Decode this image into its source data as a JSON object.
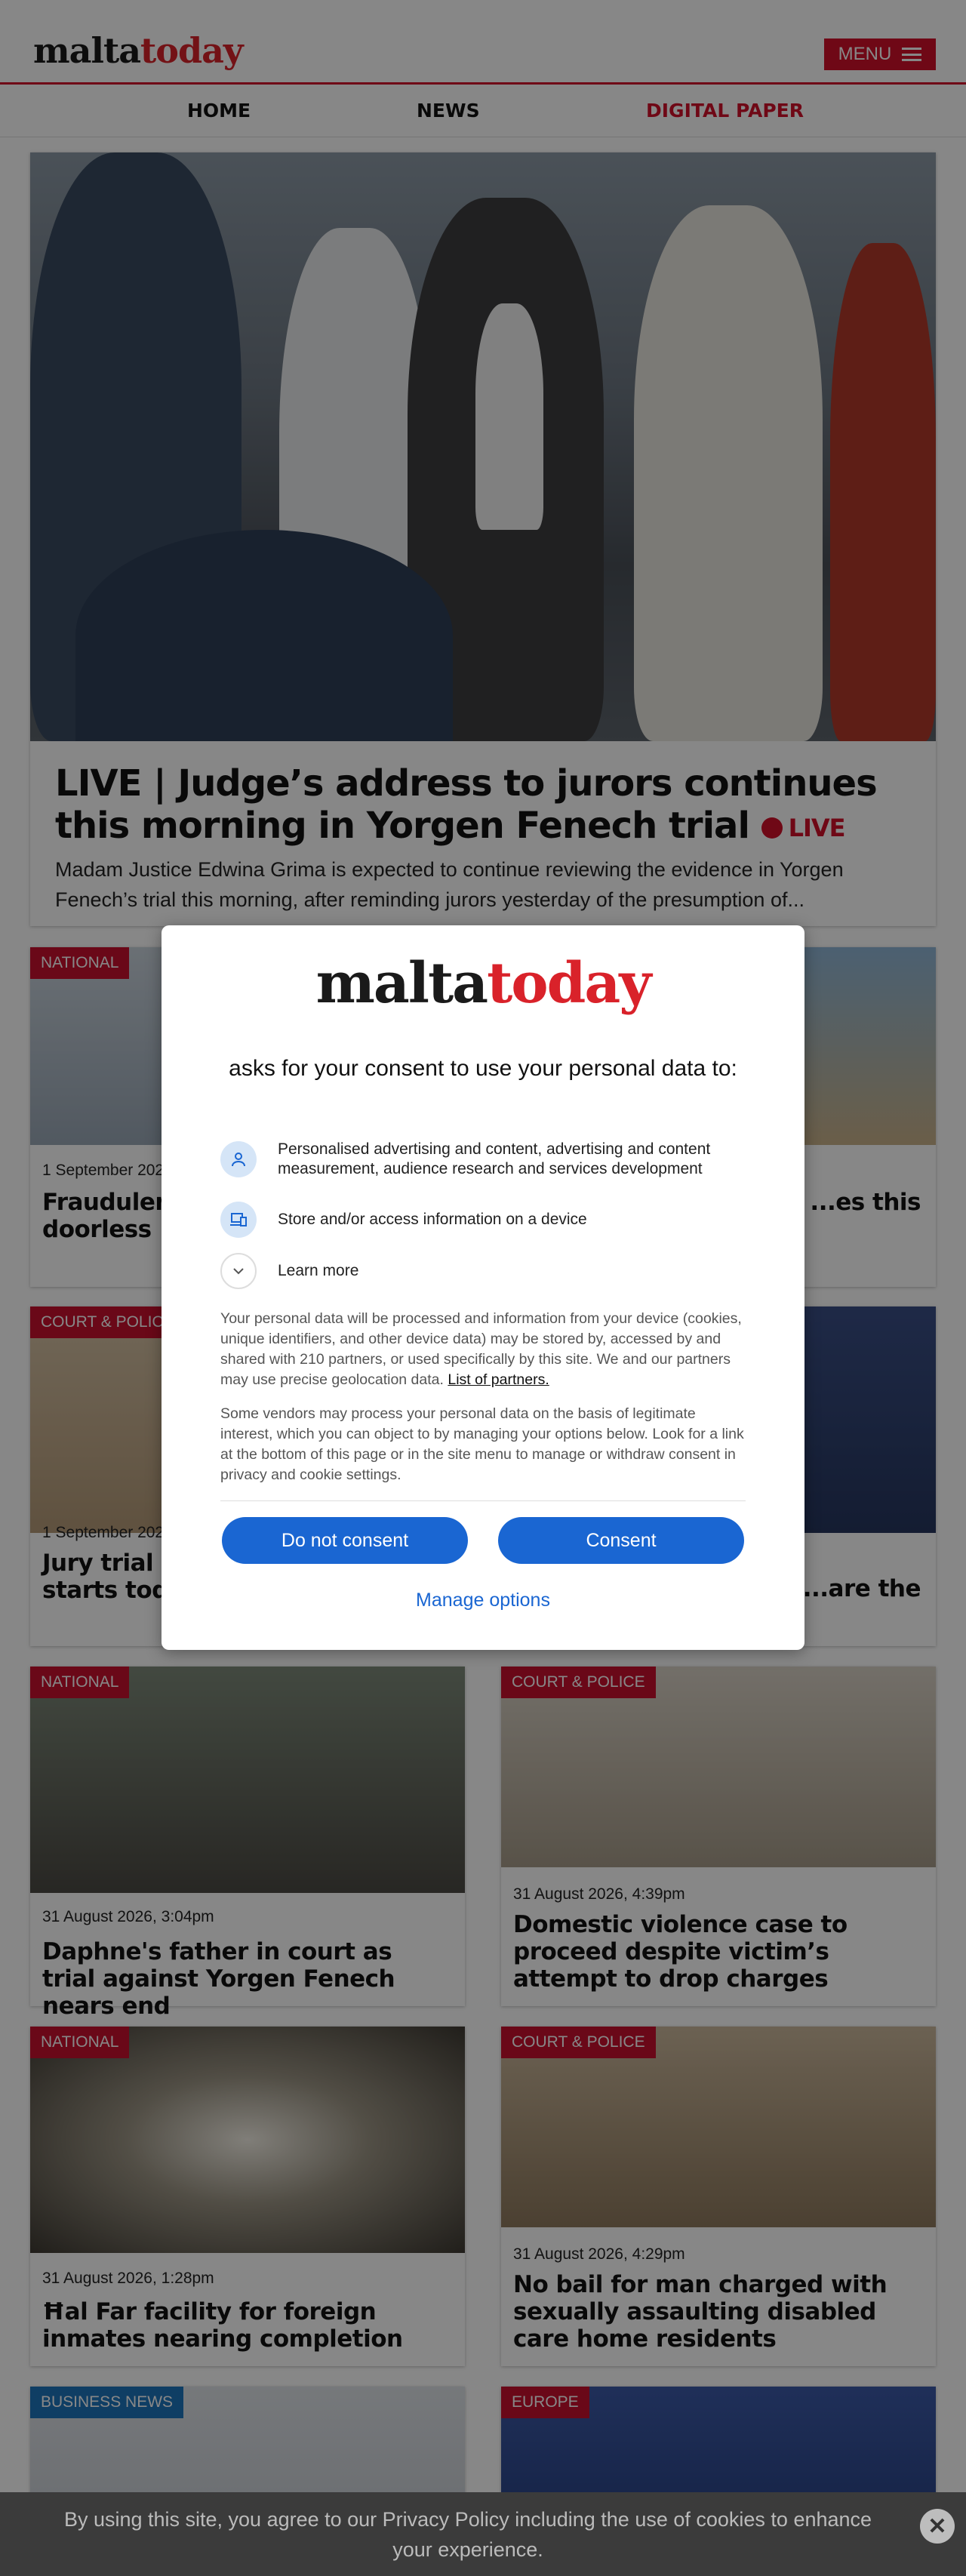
{
  "header": {
    "logo_part1": "malta",
    "logo_part2": "today",
    "menu_label": "MENU",
    "colors": {
      "brand_red": "#d1102a",
      "logo_dark": "#1a1a1a"
    }
  },
  "nav": {
    "items": [
      "HOME",
      "NEWS",
      "DIGITAL PAPER"
    ]
  },
  "hero": {
    "title": "LIVE | Judge’s address to jurors continues this morning in Yorgen Fenech trial",
    "live_label": "LIVE",
    "summary": "Madam Justice Edwina Grima is expected to continue reviewing the evidence in Yorgen Fenech’s trial this morning, after reminding jurors yesterday of the presumption of..."
  },
  "cards": [
    {
      "tag": "NATIONAL",
      "date": "1 September 2026",
      "title": "Fraudulent... leaving cus... doorless"
    },
    {
      "tag": "",
      "date": "",
      "title": "...es of ...es this"
    },
    {
      "tag": "COURT & POLICE",
      "date": "1 September 2026",
      "title": "Jury trial ov... sexual abu... starts toda..."
    },
    {
      "tag": "",
      "date": "",
      "title": "...are the"
    },
    {
      "tag": "NATIONAL",
      "date": "31 August 2026, 3:04pm",
      "title": "Daphne's father in court as trial against Yorgen Fenech nears end"
    },
    {
      "tag": "COURT & POLICE",
      "date": "31 August 2026, 4:39pm",
      "title": "Domestic violence case to proceed despite victim’s attempt to drop charges"
    },
    {
      "tag": "NATIONAL",
      "date": "31 August 2026, 1:28pm",
      "title": "Ħal Far facility for foreign inmates nearing completion"
    },
    {
      "tag": "COURT & POLICE",
      "date": "31 August 2026, 4:29pm",
      "title": "No bail for man charged with sexually assaulting disabled care home residents"
    },
    {
      "tag": "BUSINESS NEWS",
      "date": "",
      "title": ""
    },
    {
      "tag": "EUROPE",
      "date": "",
      "title": ""
    }
  ],
  "consent": {
    "heading": "asks for your consent to use your personal data to:",
    "purposes": [
      {
        "icon": "person-icon",
        "text": "Personalised advertising and content, advertising and content measurement, audience research and services development"
      },
      {
        "icon": "devices-icon",
        "text": "Store and/or access information on a device"
      },
      {
        "icon": "chevron-down-icon",
        "text": "Learn more"
      }
    ],
    "para1": "Your personal data will be processed and information from your device (cookies, unique identifiers, and other device data) may be stored by, accessed by and shared with 210 partners, or used specifically by this site. We and our partners may use precise geolocation data.",
    "partners_link": "List of partners.",
    "para2": "Some vendors may process your personal data on the basis of legitimate interest, which you can object to by managing your options below. Look for a link at the bottom of this page or in the site menu to manage or withdraw consent in privacy and cookie settings.",
    "do_not_consent": "Do not consent",
    "consent": "Consent",
    "manage": "Manage options",
    "colors": {
      "button_blue": "#1a66d2"
    }
  },
  "cookie_bar": {
    "text": "By using this site, you agree to our Privacy Policy including the use of cookies to enhance your experience.",
    "close_icon": "close-icon"
  }
}
